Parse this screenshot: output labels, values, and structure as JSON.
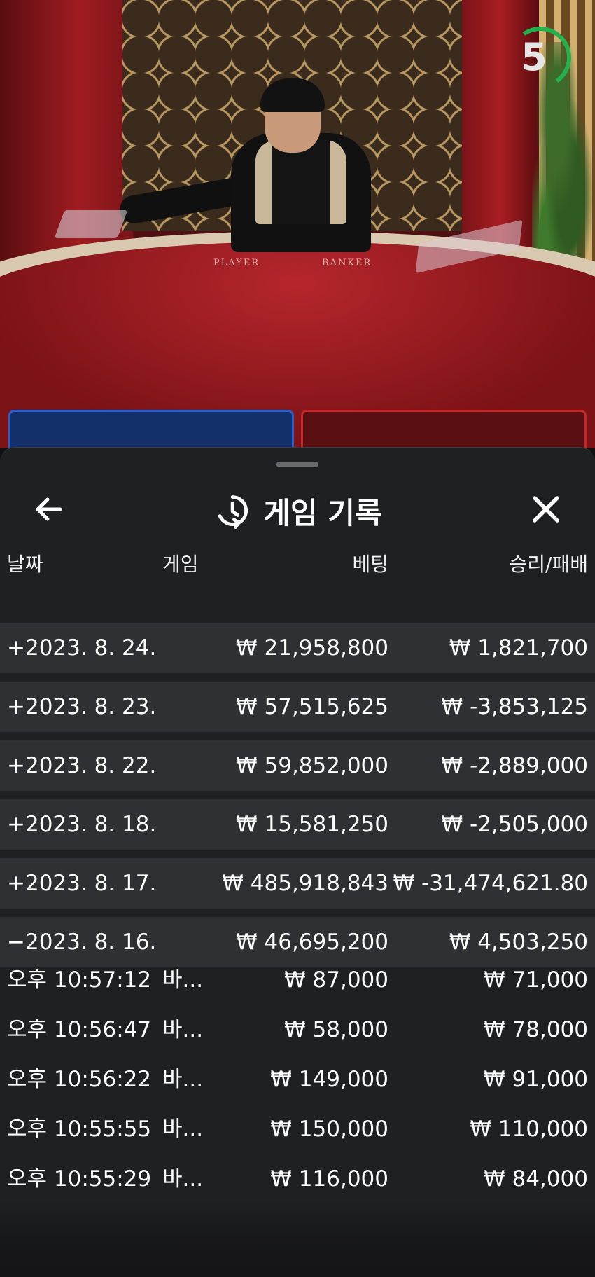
{
  "video": {
    "timer": "5",
    "felt_labels": {
      "player": "PLAYER",
      "banker": "BANKER"
    }
  },
  "sheet": {
    "title": "게임 기록",
    "icons": {
      "back": "arrow-left-icon",
      "history": "history-icon",
      "close": "close-icon"
    },
    "columns": {
      "date": "날짜",
      "game": "게임",
      "bet": "베팅",
      "result": "승리/패배"
    },
    "groups": [
      {
        "date": "+2023. 8. 24.",
        "bet": "₩ 21,958,800",
        "result": "₩ 1,821,700"
      },
      {
        "date": "+2023. 8. 23.",
        "bet": "₩ 57,515,625",
        "result": "₩ -3,853,125"
      },
      {
        "date": "+2023. 8. 22.",
        "bet": "₩ 59,852,000",
        "result": "₩ -2,889,000"
      },
      {
        "date": "+2023. 8. 18.",
        "bet": "₩ 15,581,250",
        "result": "₩ -2,505,000"
      },
      {
        "date": "+2023. 8. 17.",
        "bet": "₩ 485,918,843",
        "result": "₩ -31,474,621.80"
      },
      {
        "date": "−2023. 8. 16.",
        "bet": "₩ 46,695,200",
        "result": "₩ 4,503,250"
      }
    ],
    "details": [
      {
        "time": "오후 10:57:12",
        "game": "바...",
        "bet": "₩ 87,000",
        "result": "₩ 71,000"
      },
      {
        "time": "오후 10:56:47",
        "game": "바...",
        "bet": "₩ 58,000",
        "result": "₩ 78,000"
      },
      {
        "time": "오후 10:56:22",
        "game": "바...",
        "bet": "₩ 149,000",
        "result": "₩ 91,000"
      },
      {
        "time": "오후 10:55:55",
        "game": "바...",
        "bet": "₩ 150,000",
        "result": "₩ 110,000"
      },
      {
        "time": "오후 10:55:29",
        "game": "바...",
        "bet": "₩ 116,000",
        "result": "₩ 84,000"
      }
    ]
  },
  "colors": {
    "sheet_bg": "#202123",
    "group_row_bg": "#2f3033",
    "timer_green": "#23b14d",
    "player_blue": "#2a5fc9",
    "banker_red": "#c9262c"
  }
}
